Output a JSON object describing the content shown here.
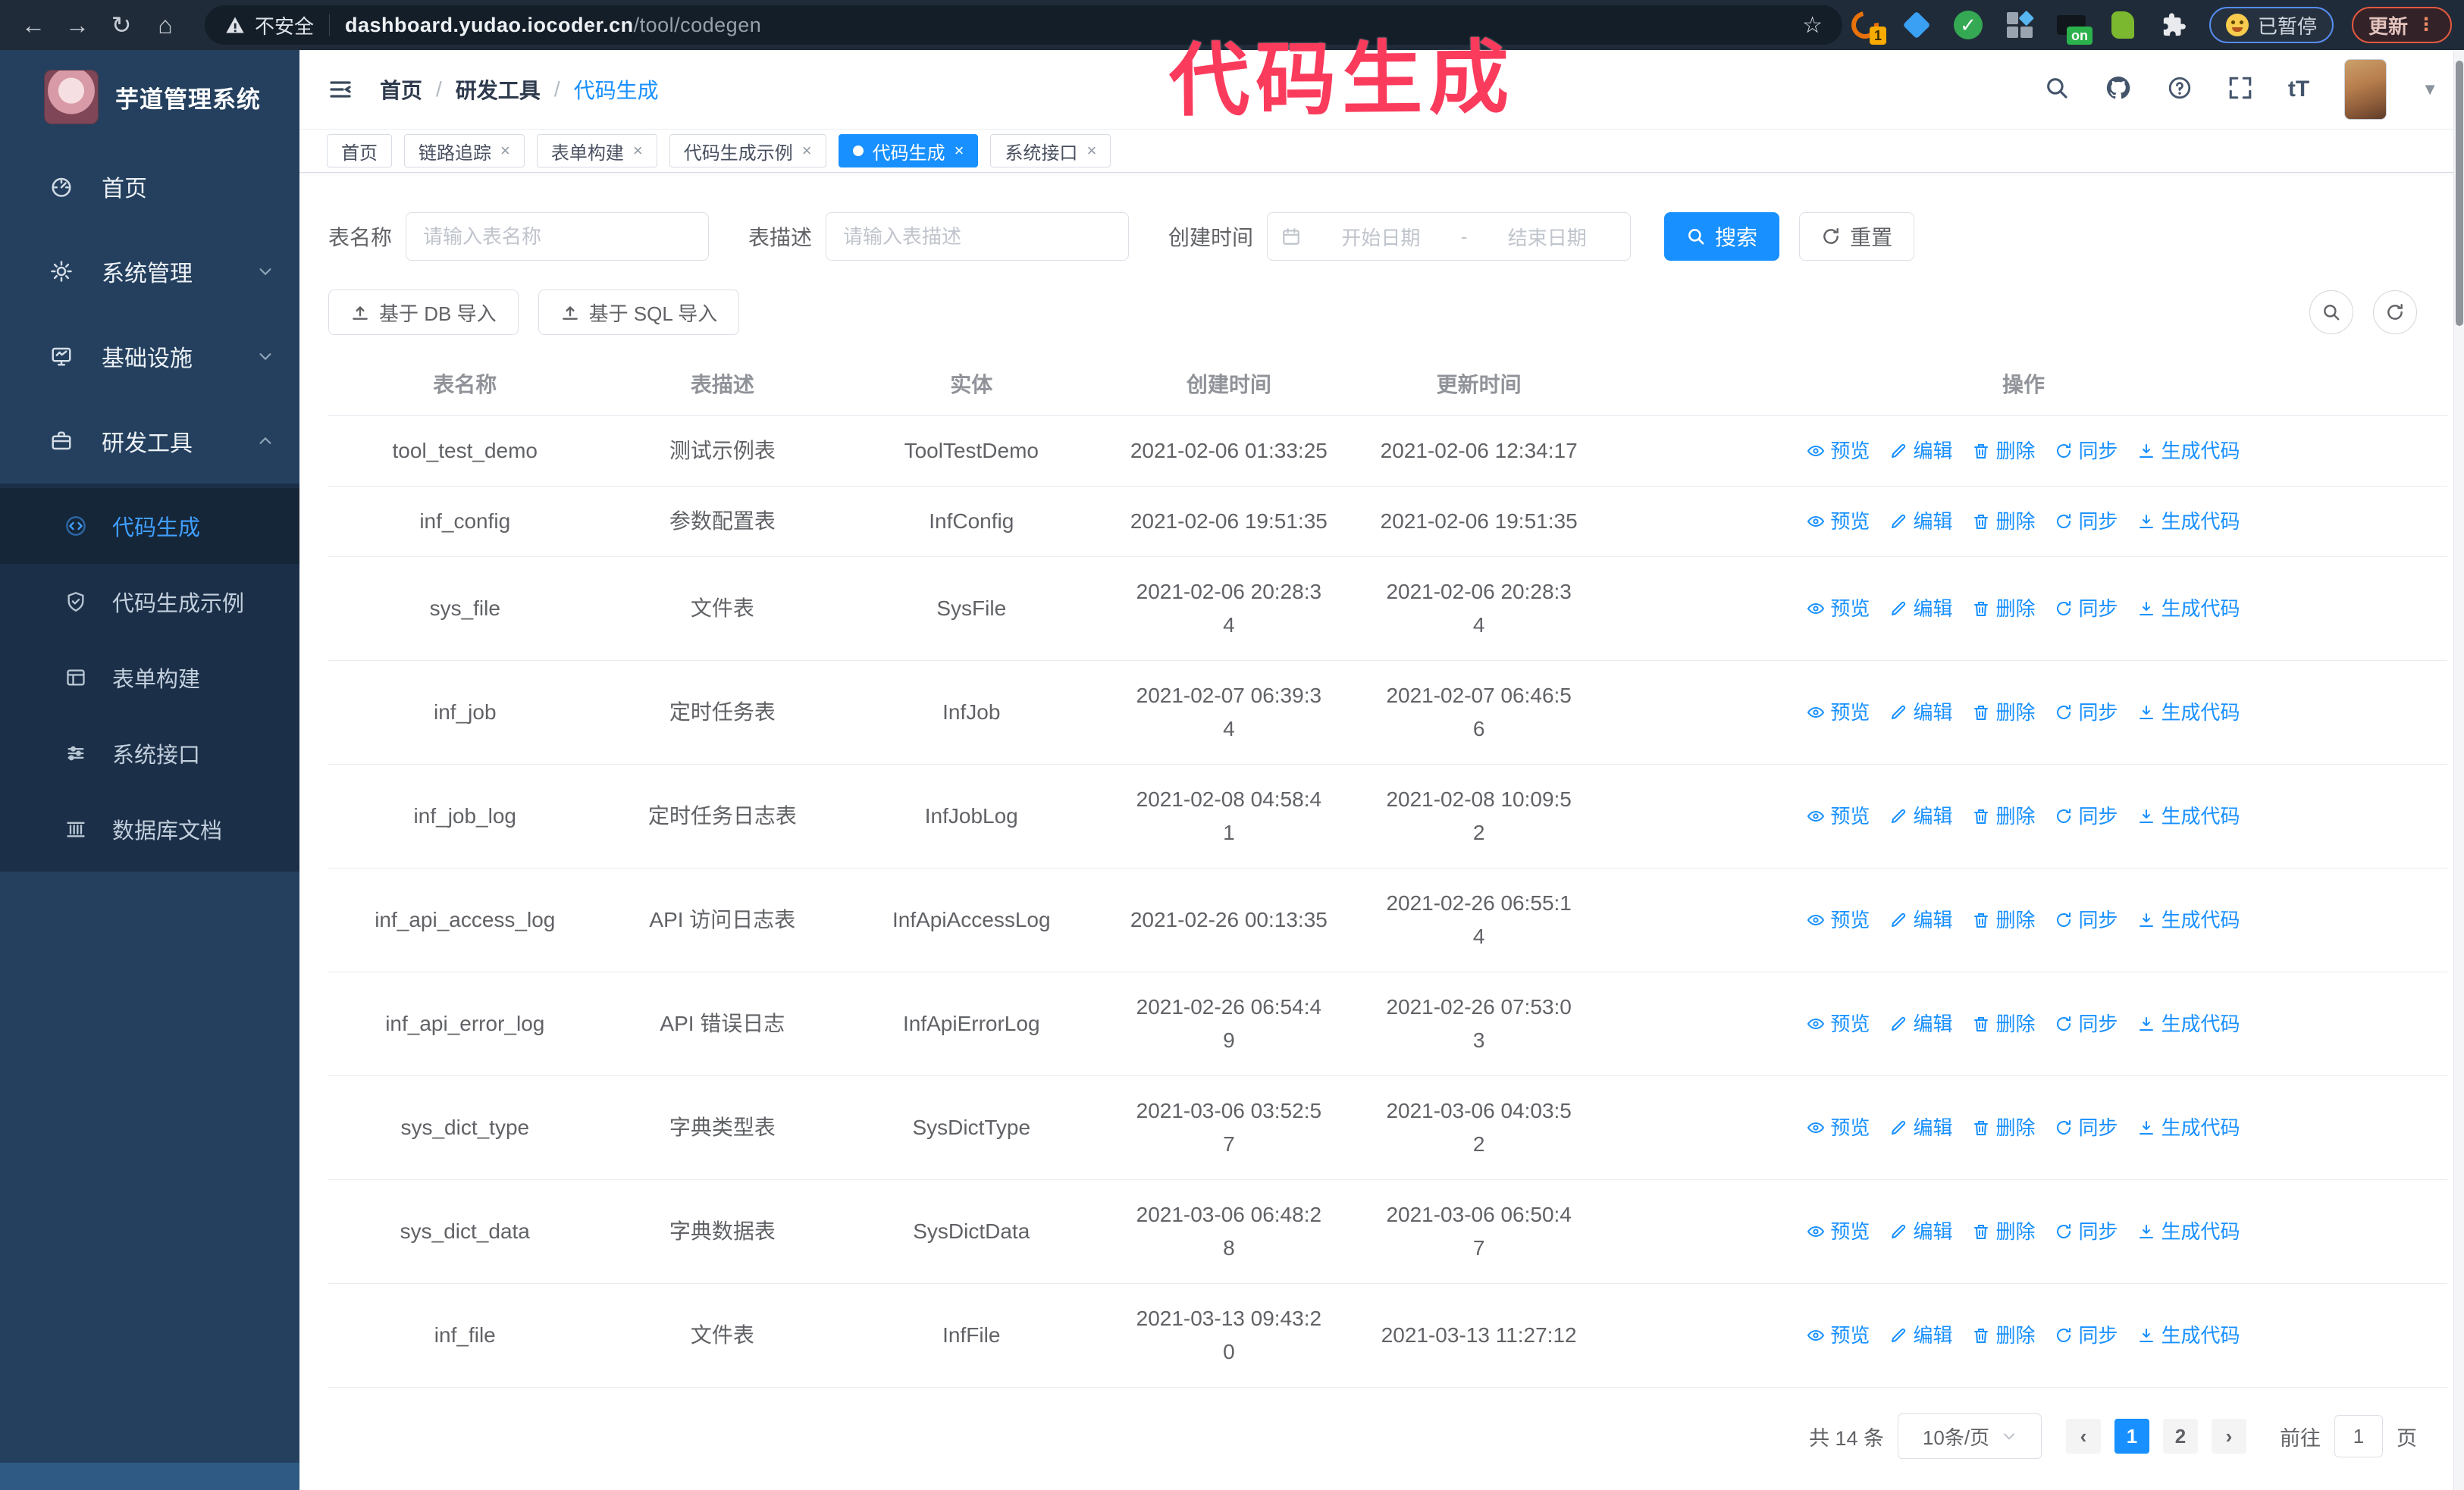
{
  "colors": {
    "accent": "#1890ff",
    "sidebar_bg": "#24405e",
    "submenu_bg": "#1b3048",
    "chrome_bg": "#202b39",
    "annotation": "#fb3b5c",
    "active_tab": "#1890ff",
    "link_blue": "#1890ff"
  },
  "annotation": {
    "text": "代码生成"
  },
  "browser": {
    "security_label": "不安全",
    "url_host": "dashboard.yudao.iocoder.cn",
    "url_path": "/tool/codegen",
    "extension_badge_count": "1",
    "extension_badge_on": "on",
    "paused_badge": "已暂停",
    "update_button": "更新",
    "menu_dots": "⋮"
  },
  "sidebar": {
    "title": "芋道管理系统",
    "items": [
      {
        "label": "首页",
        "icon": "dashboard-icon"
      },
      {
        "label": "系统管理",
        "icon": "gear-icon"
      },
      {
        "label": "基础设施",
        "icon": "monitor-icon"
      },
      {
        "label": "研发工具",
        "icon": "toolbox-icon"
      }
    ],
    "submenu": [
      {
        "label": "代码生成",
        "icon": "code-icon"
      },
      {
        "label": "代码生成示例",
        "icon": "shield-check-icon"
      },
      {
        "label": "表单构建",
        "icon": "form-icon"
      },
      {
        "label": "系统接口",
        "icon": "sliders-icon"
      },
      {
        "label": "数据库文档",
        "icon": "columns-icon"
      }
    ]
  },
  "header": {
    "breadcrumb": [
      "首页",
      "研发工具",
      "代码生成"
    ],
    "separator": "/"
  },
  "tabs": [
    {
      "label": "首页"
    },
    {
      "label": "链路追踪"
    },
    {
      "label": "表单构建"
    },
    {
      "label": "代码生成示例"
    },
    {
      "label": "代码生成"
    },
    {
      "label": "系统接口"
    }
  ],
  "filters": {
    "table_name_label": "表名称",
    "table_name_placeholder": "请输入表名称",
    "table_desc_label": "表描述",
    "table_desc_placeholder": "请输入表描述",
    "create_time_label": "创建时间",
    "date_start_placeholder": "开始日期",
    "date_separator": "-",
    "date_end_placeholder": "结束日期",
    "search_button": "搜索",
    "reset_button": "重置"
  },
  "toolbar": {
    "import_db_button": "基于 DB 导入",
    "import_sql_button": "基于 SQL 导入"
  },
  "table": {
    "columns": [
      "表名称",
      "表描述",
      "实体",
      "创建时间",
      "更新时间",
      "操作"
    ],
    "row_actions": [
      "预览",
      "编辑",
      "删除",
      "同步",
      "生成代码"
    ],
    "rows": [
      {
        "name": "tool_test_demo",
        "desc": "测试示例表",
        "entity": "ToolTestDemo",
        "created": "2021-02-06 01:33:25",
        "updated": "2021-02-06 12:34:17"
      },
      {
        "name": "inf_config",
        "desc": "参数配置表",
        "entity": "InfConfig",
        "created": "2021-02-06 19:51:35",
        "updated": "2021-02-06 19:51:35"
      },
      {
        "name": "sys_file",
        "desc": "文件表",
        "entity": "SysFile",
        "created": "2021-02-06 20:28:3\n4",
        "updated": "2021-02-06 20:28:3\n4"
      },
      {
        "name": "inf_job",
        "desc": "定时任务表",
        "entity": "InfJob",
        "created": "2021-02-07 06:39:3\n4",
        "updated": "2021-02-07 06:46:5\n6"
      },
      {
        "name": "inf_job_log",
        "desc": "定时任务日志表",
        "entity": "InfJobLog",
        "created": "2021-02-08 04:58:4\n1",
        "updated": "2021-02-08 10:09:5\n2"
      },
      {
        "name": "inf_api_access_log",
        "desc": "API 访问日志表",
        "entity": "InfApiAccessLog",
        "created": "2021-02-26 00:13:35",
        "updated": "2021-02-26 06:55:1\n4"
      },
      {
        "name": "inf_api_error_log",
        "desc": "API 错误日志",
        "entity": "InfApiErrorLog",
        "created": "2021-02-26 06:54:4\n9",
        "updated": "2021-02-26 07:53:0\n3"
      },
      {
        "name": "sys_dict_type",
        "desc": "字典类型表",
        "entity": "SysDictType",
        "created": "2021-03-06 03:52:5\n7",
        "updated": "2021-03-06 04:03:5\n2"
      },
      {
        "name": "sys_dict_data",
        "desc": "字典数据表",
        "entity": "SysDictData",
        "created": "2021-03-06 06:48:2\n8",
        "updated": "2021-03-06 06:50:4\n7"
      },
      {
        "name": "inf_file",
        "desc": "文件表",
        "entity": "InfFile",
        "created": "2021-03-13 09:43:2\n0",
        "updated": "2021-03-13 11:27:12"
      }
    ]
  },
  "pagination": {
    "total": "共 14 条",
    "page_size": "10条/页",
    "prev": "‹",
    "pages": [
      "1",
      "2"
    ],
    "next": "›",
    "goto_label": "前往",
    "goto_value": "1",
    "page_label": "页"
  }
}
